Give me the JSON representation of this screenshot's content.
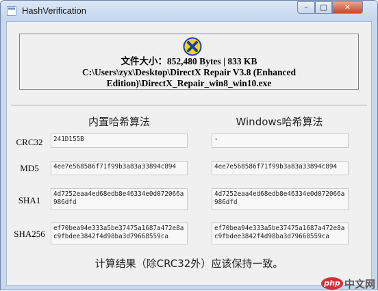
{
  "window": {
    "title": "HashVerification",
    "minimize": "–",
    "maximize": "□",
    "close": "✕"
  },
  "info": {
    "line1": "文件大小：852,480 Bytes | 833 KB",
    "line2": "C:\\Users\\zyx\\Desktop\\DirectX Repair V3.8 (Enhanced",
    "line3": "Edition)\\DirectX_Repair_win8_win10.exe"
  },
  "columns": {
    "builtin": "内置哈希算法",
    "windows": "Windows哈希算法"
  },
  "rows": [
    {
      "label": "CRC32",
      "builtin": "241D155B",
      "windows": "-"
    },
    {
      "label": "MD5",
      "builtin": "4ee7e568586f71f99b3a83a33894c894",
      "windows": "4ee7e568586f71f99b3a83a33894c894"
    },
    {
      "label": "SHA1",
      "builtin": "4d7252eaa4ed68edb8e46334e0d072066a986dfd",
      "windows": "4d7252eaa4ed68edb8e46334e0d072066a986dfd"
    },
    {
      "label": "SHA256",
      "builtin": "ef70bea94e333a5be37475a1687a472e8ac9fbdee3842f4d98ba3d79668559ca",
      "windows": "ef70bea94e333a5be37475a1687a472e8ac9fbdee3842f4d98ba3d79668559ca"
    }
  ],
  "footer": "计算结果（除CRC32外）应该保持一致。",
  "watermark": {
    "badge": "php",
    "text": "中文网"
  }
}
